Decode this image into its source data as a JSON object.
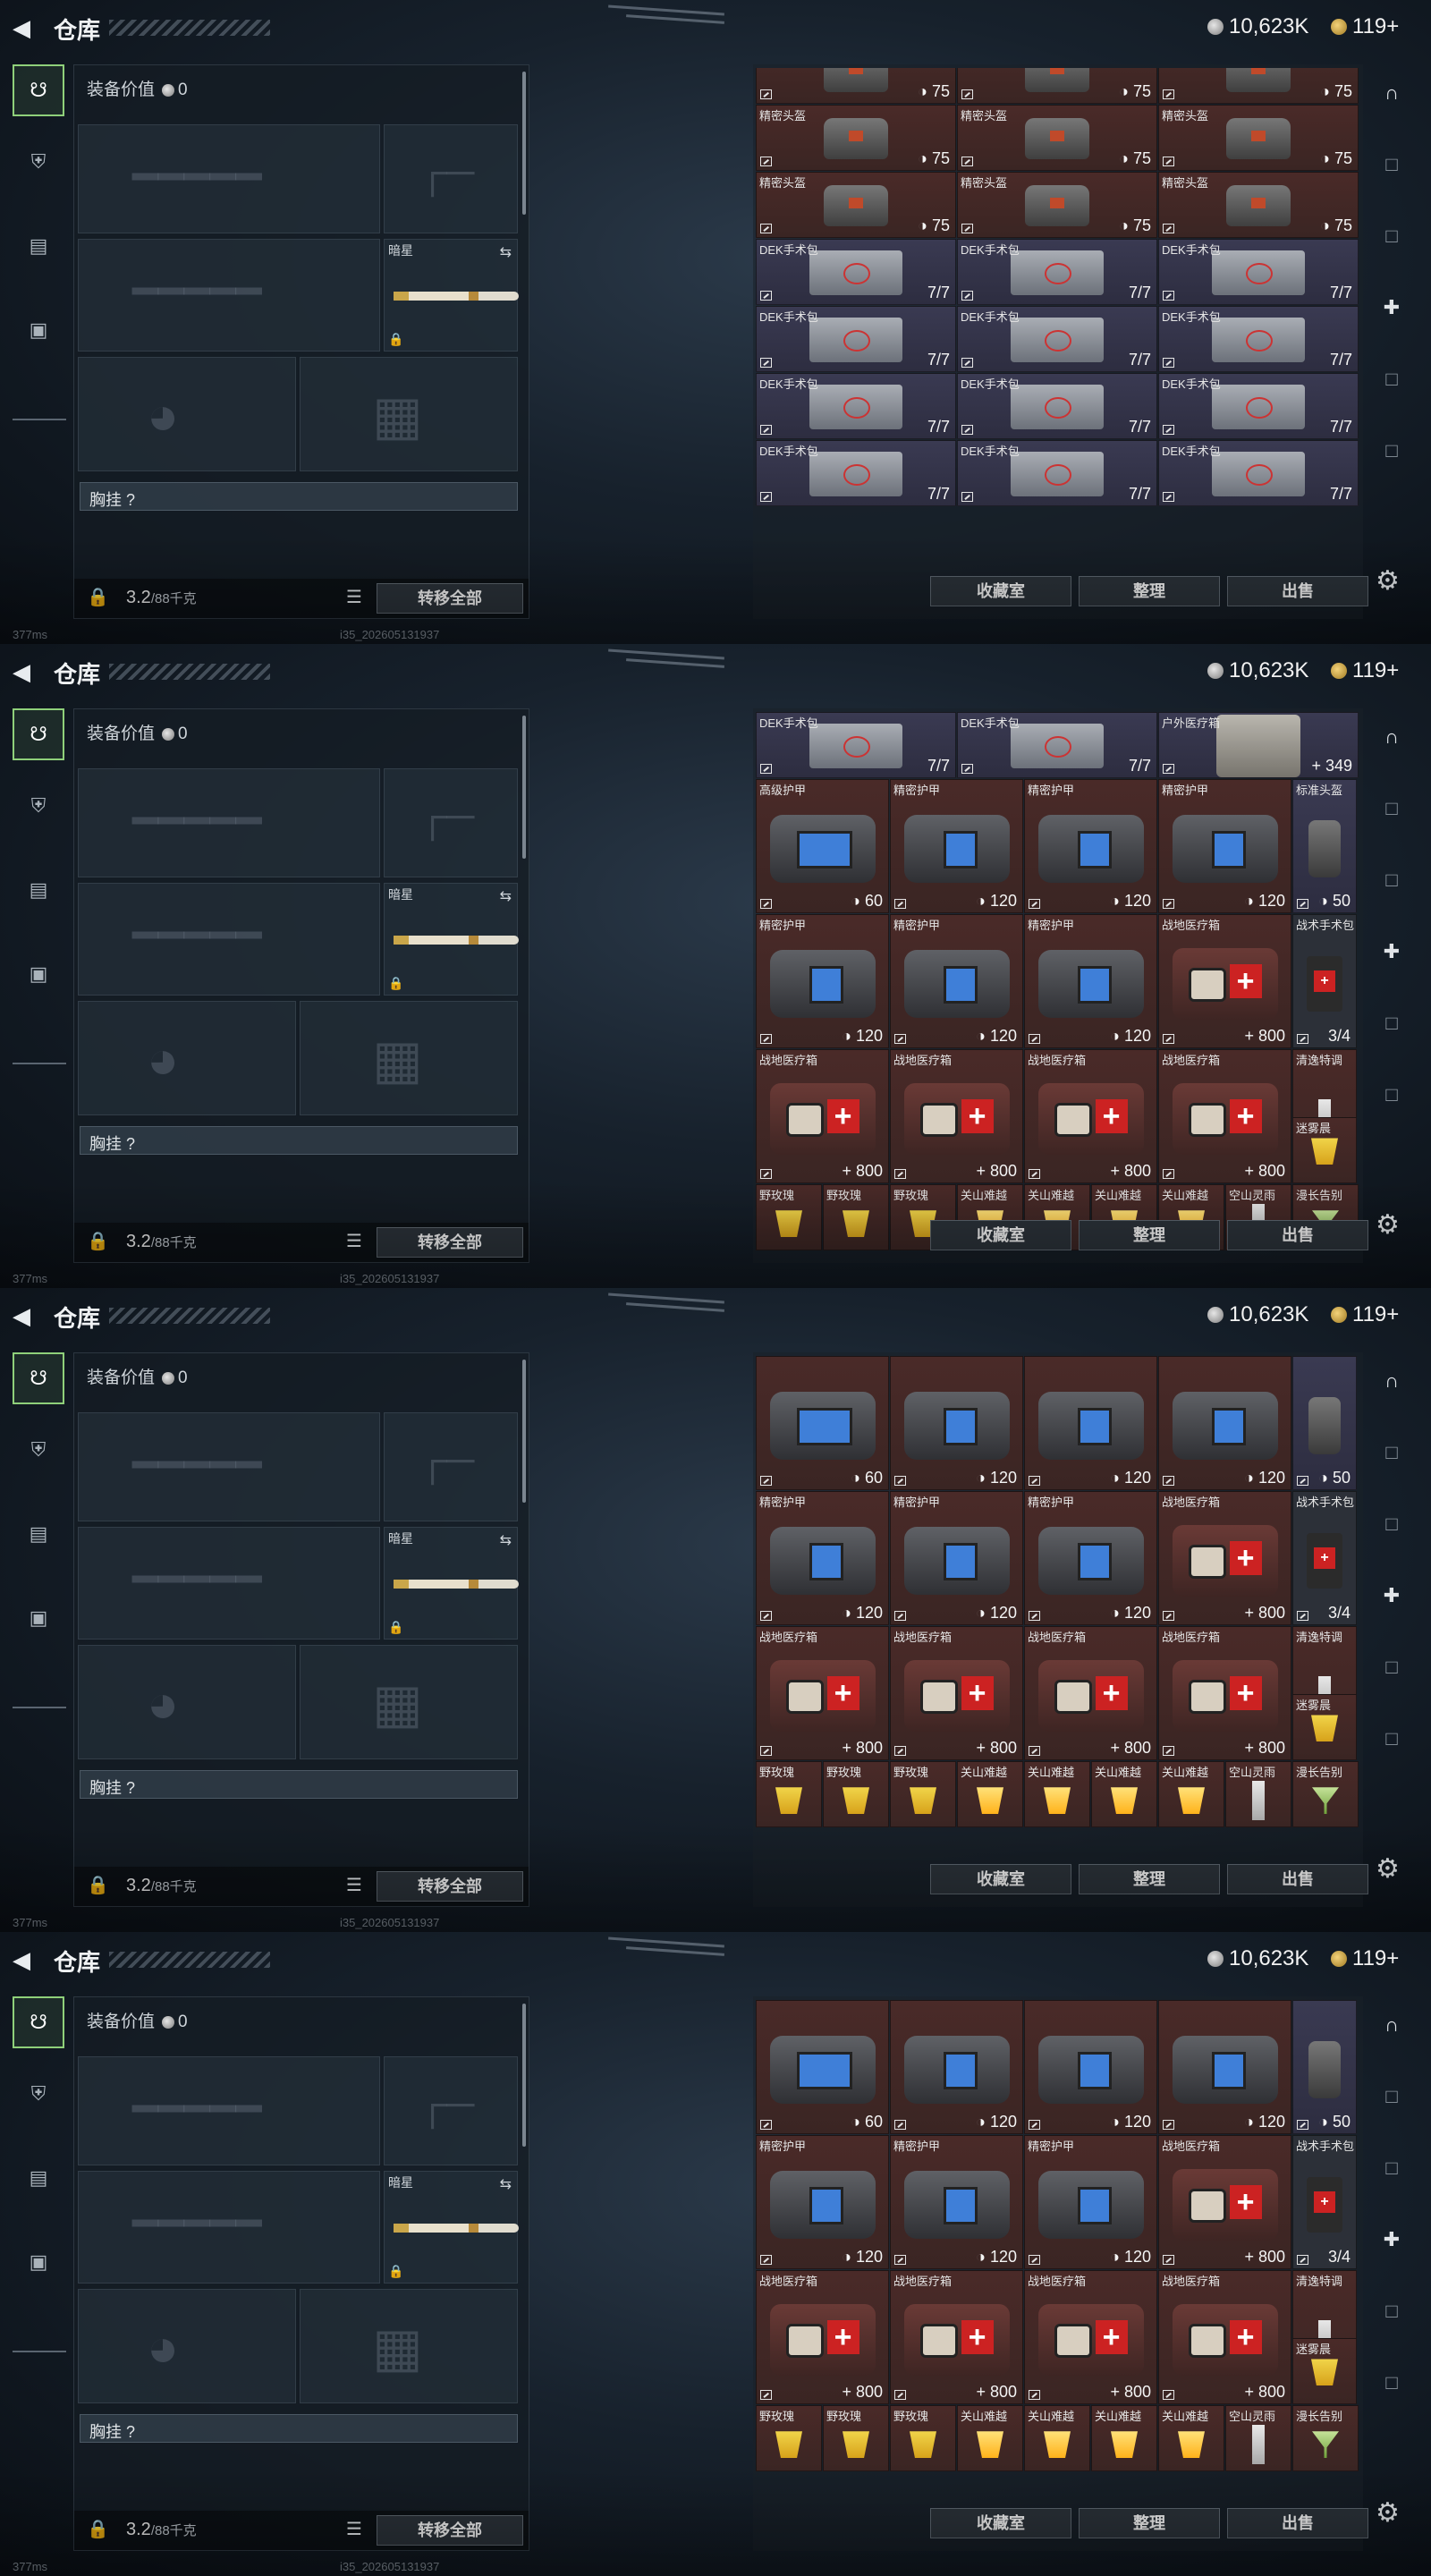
{
  "title": "仓库",
  "currency": {
    "silver": "10,623K",
    "gold": "119+"
  },
  "left_panel": {
    "equip_value_label": "装备价值",
    "equip_value": "0",
    "secondary_slot_label": "暗星",
    "chest_label": "胸挂 ?",
    "weight": "3.2",
    "weight_max": "/88千克",
    "transfer_all": "转移全部"
  },
  "buttons": {
    "collection": "收藏室",
    "organize": "整理",
    "sell": "出售"
  },
  "status": {
    "ping": "377ms",
    "version": "i35_202605131937"
  },
  "screens": [
    {
      "rows": [
        [
          {
            "name": "",
            "value": "75",
            "icon": "helmet",
            "bg": "red"
          },
          {
            "name": "",
            "value": "75",
            "icon": "helmet",
            "bg": "red"
          },
          {
            "name": "",
            "value": "75",
            "icon": "helmet",
            "bg": "red"
          }
        ],
        [
          {
            "name": "精密头盔",
            "value": "75",
            "icon": "helmet",
            "bg": "red"
          },
          {
            "name": "精密头盔",
            "value": "75",
            "icon": "helmet",
            "bg": "red"
          },
          {
            "name": "精密头盔",
            "value": "75",
            "icon": "helmet",
            "bg": "red"
          }
        ],
        [
          {
            "name": "精密头盔",
            "value": "75",
            "icon": "helmet",
            "bg": "red"
          },
          {
            "name": "精密头盔",
            "value": "75",
            "icon": "helmet",
            "bg": "red"
          },
          {
            "name": "精密头盔",
            "value": "75",
            "icon": "helmet",
            "bg": "red"
          }
        ],
        [
          {
            "name": "DEK手术包",
            "value": "7/7",
            "icon": "medkit",
            "bg": "purple"
          },
          {
            "name": "DEK手术包",
            "value": "7/7",
            "icon": "medkit",
            "bg": "purple"
          },
          {
            "name": "DEK手术包",
            "value": "7/7",
            "icon": "medkit",
            "bg": "purple"
          }
        ],
        [
          {
            "name": "DEK手术包",
            "value": "7/7",
            "icon": "medkit",
            "bg": "purple"
          },
          {
            "name": "DEK手术包",
            "value": "7/7",
            "icon": "medkit",
            "bg": "purple"
          },
          {
            "name": "DEK手术包",
            "value": "7/7",
            "icon": "medkit",
            "bg": "purple"
          }
        ],
        [
          {
            "name": "DEK手术包",
            "value": "7/7",
            "icon": "medkit",
            "bg": "purple"
          },
          {
            "name": "DEK手术包",
            "value": "7/7",
            "icon": "medkit",
            "bg": "purple"
          },
          {
            "name": "DEK手术包",
            "value": "7/7",
            "icon": "medkit",
            "bg": "purple"
          }
        ],
        [
          {
            "name": "DEK手术包",
            "value": "7/7",
            "icon": "medkit",
            "bg": "purple"
          },
          {
            "name": "DEK手术包",
            "value": "7/7",
            "icon": "medkit",
            "bg": "purple"
          },
          {
            "name": "DEK手术包",
            "value": "7/7",
            "icon": "medkit",
            "bg": "purple"
          }
        ]
      ]
    },
    {
      "top": [
        {
          "name": "DEK手术包",
          "value": "7/7",
          "icon": "medkit",
          "bg": "purple"
        },
        {
          "name": "DEK手术包",
          "value": "7/7",
          "icon": "medkit",
          "bg": "purple"
        },
        {
          "name": "户外医疗箱",
          "value": "349",
          "icon": "bag",
          "bg": "purple"
        }
      ],
      "armor": [
        [
          {
            "name": "高级护甲",
            "value": "60",
            "icon": "armor-big",
            "bg": "red"
          },
          {
            "name": "精密护甲",
            "value": "120",
            "icon": "armor",
            "bg": "red"
          },
          {
            "name": "精密护甲",
            "value": "120",
            "icon": "armor",
            "bg": "red"
          },
          {
            "name": "精密护甲",
            "value": "120",
            "icon": "armor",
            "bg": "red"
          },
          {
            "name": "标准头盔",
            "value": "50",
            "icon": "lantern",
            "bg": "purple"
          }
        ],
        [
          {
            "name": "精密护甲",
            "value": "120",
            "icon": "armor",
            "bg": "red"
          },
          {
            "name": "精密护甲",
            "value": "120",
            "icon": "armor",
            "bg": "red"
          },
          {
            "name": "精密护甲",
            "value": "120",
            "icon": "armor",
            "bg": "red"
          },
          {
            "name": "战地医疗箱",
            "value": "800",
            "icon": "fieldkit",
            "bg": "red"
          },
          {
            "name": "战术手术包",
            "value": "3/4",
            "icon": "redkit",
            "bg": "dark"
          }
        ],
        [
          {
            "name": "战地医疗箱",
            "value": "800",
            "icon": "fieldkit",
            "bg": "red"
          },
          {
            "name": "战地医疗箱",
            "value": "800",
            "icon": "fieldkit",
            "bg": "red"
          },
          {
            "name": "战地医疗箱",
            "value": "800",
            "icon": "fieldkit",
            "bg": "red"
          },
          {
            "name": "战地医疗箱",
            "value": "800",
            "icon": "fieldkit",
            "bg": "red"
          },
          {
            "name": "清逸特调",
            "value": "",
            "icon": "glass-c",
            "bg": "red"
          }
        ]
      ],
      "side_extra": {
        "name": "迷雾晨",
        "icon": "glass"
      },
      "drinks": [
        "野玫瑰",
        "野玫瑰",
        "野玫瑰",
        "关山难越",
        "关山难越",
        "关山难越",
        "关山难越",
        "空山灵雨",
        "漫长告别"
      ]
    },
    {
      "armor": [
        [
          {
            "name": "",
            "value": "60",
            "icon": "armor-big",
            "bg": "red"
          },
          {
            "name": "",
            "value": "120",
            "icon": "armor",
            "bg": "red"
          },
          {
            "name": "",
            "value": "120",
            "icon": "armor",
            "bg": "red"
          },
          {
            "name": "",
            "value": "120",
            "icon": "armor",
            "bg": "red"
          },
          {
            "name": "",
            "value": "50",
            "icon": "lantern",
            "bg": "purple"
          }
        ],
        [
          {
            "name": "精密护甲",
            "value": "120",
            "icon": "armor",
            "bg": "red"
          },
          {
            "name": "精密护甲",
            "value": "120",
            "icon": "armor",
            "bg": "red"
          },
          {
            "name": "精密护甲",
            "value": "120",
            "icon": "armor",
            "bg": "red"
          },
          {
            "name": "战地医疗箱",
            "value": "800",
            "icon": "fieldkit",
            "bg": "red"
          },
          {
            "name": "战术手术包",
            "value": "3/4",
            "icon": "redkit",
            "bg": "dark"
          }
        ],
        [
          {
            "name": "战地医疗箱",
            "value": "800",
            "icon": "fieldkit",
            "bg": "red"
          },
          {
            "name": "战地医疗箱",
            "value": "800",
            "icon": "fieldkit",
            "bg": "red"
          },
          {
            "name": "战地医疗箱",
            "value": "800",
            "icon": "fieldkit",
            "bg": "red"
          },
          {
            "name": "战地医疗箱",
            "value": "800",
            "icon": "fieldkit",
            "bg": "red"
          },
          {
            "name": "清逸特调",
            "value": "",
            "icon": "glass-c",
            "bg": "red"
          }
        ]
      ],
      "side_extra": {
        "name": "迷雾晨",
        "icon": "glass"
      },
      "drinks": [
        "野玫瑰",
        "野玫瑰",
        "野玫瑰",
        "关山难越",
        "关山难越",
        "关山难越",
        "关山难越",
        "空山灵雨",
        "漫长告别"
      ]
    },
    {
      "armor": [
        [
          {
            "name": "",
            "value": "60",
            "icon": "armor-big",
            "bg": "red"
          },
          {
            "name": "",
            "value": "120",
            "icon": "armor",
            "bg": "red"
          },
          {
            "name": "",
            "value": "120",
            "icon": "armor",
            "bg": "red"
          },
          {
            "name": "",
            "value": "120",
            "icon": "armor",
            "bg": "red"
          },
          {
            "name": "",
            "value": "50",
            "icon": "lantern",
            "bg": "purple"
          }
        ],
        [
          {
            "name": "精密护甲",
            "value": "120",
            "icon": "armor",
            "bg": "red"
          },
          {
            "name": "精密护甲",
            "value": "120",
            "icon": "armor",
            "bg": "red"
          },
          {
            "name": "精密护甲",
            "value": "120",
            "icon": "armor",
            "bg": "red"
          },
          {
            "name": "战地医疗箱",
            "value": "800",
            "icon": "fieldkit",
            "bg": "red"
          },
          {
            "name": "战术手术包",
            "value": "3/4",
            "icon": "redkit",
            "bg": "dark"
          }
        ],
        [
          {
            "name": "战地医疗箱",
            "value": "800",
            "icon": "fieldkit",
            "bg": "red"
          },
          {
            "name": "战地医疗箱",
            "value": "800",
            "icon": "fieldkit",
            "bg": "red"
          },
          {
            "name": "战地医疗箱",
            "value": "800",
            "icon": "fieldkit",
            "bg": "red"
          },
          {
            "name": "战地医疗箱",
            "value": "800",
            "icon": "fieldkit",
            "bg": "red"
          },
          {
            "name": "清逸特调",
            "value": "",
            "icon": "glass-c",
            "bg": "red"
          }
        ]
      ],
      "side_extra": {
        "name": "迷雾晨",
        "icon": "glass"
      },
      "drinks": [
        "野玫瑰",
        "野玫瑰",
        "野玫瑰",
        "关山难越",
        "关山难越",
        "关山难越",
        "关山难越",
        "空山灵雨",
        "漫长告别"
      ]
    }
  ]
}
